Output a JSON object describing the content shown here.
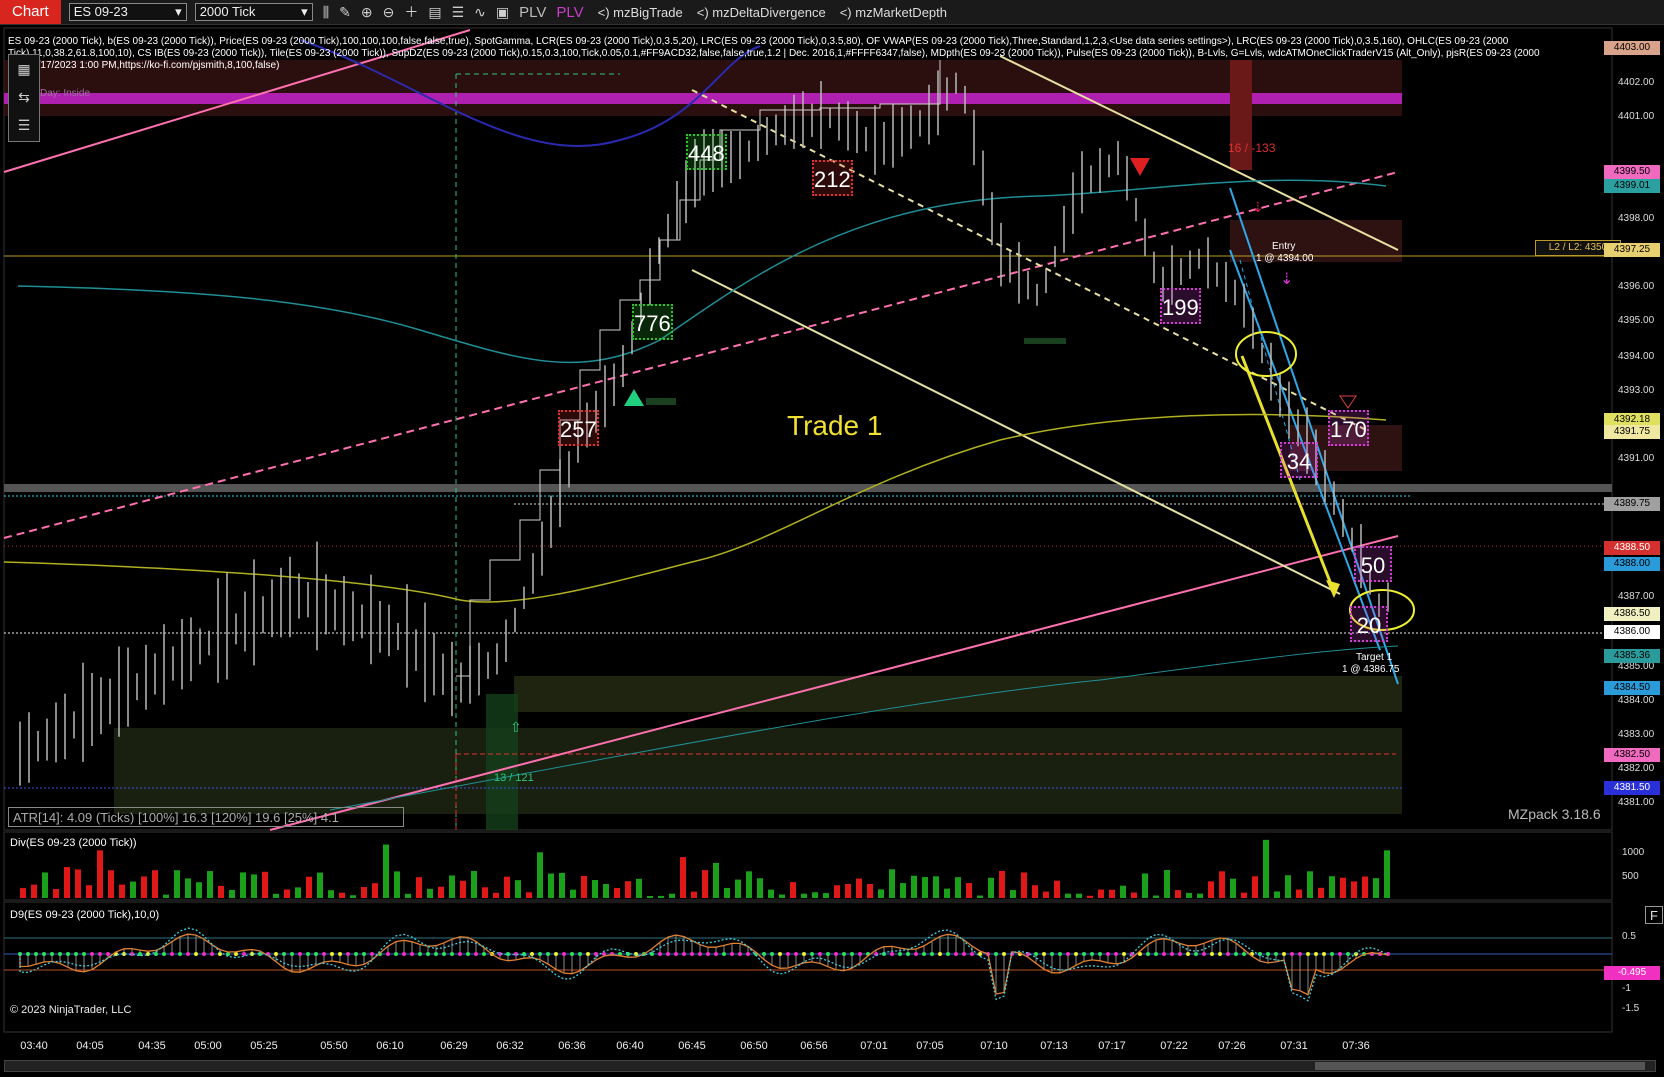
{
  "toolbar": {
    "chart_tab": "Chart",
    "instrument": "ES 09-23",
    "bar_type": "2000 Tick",
    "plv1": "PLV",
    "plv2": "PLV",
    "ind1": "<) mzBigTrade",
    "ind2": "<) mzDeltaDivergence",
    "ind3": "<) mzMarketDepth",
    "icons": [
      "bar-style-icon",
      "draw-pencil-icon",
      "zoom-in-icon",
      "zoom-out-icon",
      "crosshair-icon",
      "data-box-icon",
      "properties-icon",
      "strategy-icon",
      "templates-icon"
    ]
  },
  "info_line": "ES 09-23 (2000 Tick), b(ES 09-23 (2000 Tick)), Price(ES 09-23 (2000 Tick),100,100,100,false,false,true), SpotGamma, LCR(ES 09-23 (2000 Tick),0,3.5,20), LRC(ES 09-23 (2000 Tick),0,3.5,80), OF VWAP(ES 09-23 (2000 Tick),Three,Standard,1,2,3,<Use data series settings>), LRC(ES 09-23 (2000 Tick),0,3.5,160), OHLC(ES 09-23 (2000 Tick),11,0,38.2,61.8,100,10), CS IB(ES 09-23 (2000 Tick)), Tile(ES 09-23 (2000 Tick)), SupDZ(ES 09-23 (2000 Tick),0.15,0.3,100,Tick,0.05,0.1,#FF9ACD32,false,false,true,1.2 | Dec. 2016,1,#FFFF6347,false), MDpth(ES 09-23 (2000 Tick)), Pulse(ES 09-23 (2000 Tick)), B-Lvls, G=Lvls, wdcATMOneClickTraderV15 (Alt_Only), pjsR(ES 09-23 (2000 Tick),6/17/2023 1:00 PM,https://ko-fi.com/pjsmith,8,100,false)",
  "labels": {
    "day_inside": "Day: Inside",
    "trade": "Trade 1",
    "entry_title": "Entry",
    "entry_detail": "1 @ 4394.00",
    "target_title": "Target 1",
    "target_detail": "1 @ 4386.75",
    "delta_top": "16 / -133",
    "delta_bottom": "13 / 121",
    "level_label": "L2 / L2: 4350",
    "atr": "ATR[14]: 4.09 (Ticks) [100%] 16.3 [120%] 19.6 [25%] 4.1",
    "mzpack": "MZpack 3.18.6",
    "div_title": "Div(ES 09-23 (2000 Tick))",
    "d9_title": "D9(ES 09-23 (2000 Tick),10,0)",
    "copyright": "© 2023 NinjaTrader, LLC",
    "f_button": "F"
  },
  "bigtrades": [
    {
      "text": "448",
      "color": "#2ec12e"
    },
    {
      "text": "212",
      "color": "#e03030"
    },
    {
      "text": "776",
      "color": "#2ec12e"
    },
    {
      "text": "257",
      "color": "#e03030"
    },
    {
      "text": "199",
      "color": "#d040d0"
    },
    {
      "text": "170",
      "color": "#d040d0"
    },
    {
      "text": "34",
      "color": "#d040d0"
    },
    {
      "text": "50",
      "color": "#d040d0"
    },
    {
      "text": "20",
      "color": "#d040d0"
    }
  ],
  "price_ticks": [
    "4402.00",
    "4401.00",
    "4399.00",
    "4398.00",
    "4396.00",
    "4395.00",
    "4394.00",
    "4393.00",
    "4391.00",
    "4387.00",
    "4386.00",
    "4385.00",
    "4384.00",
    "4383.00",
    "4382.00",
    "4381.00"
  ],
  "price_boxes": [
    {
      "text": "4403.00",
      "bg": "#d9a28a",
      "fg": "#000"
    },
    {
      "text": "4399.50",
      "bg": "#f06ac0",
      "fg": "#000"
    },
    {
      "text": "4399.01",
      "bg": "#2aa0a0",
      "fg": "#000"
    },
    {
      "text": "4397.25",
      "bg": "#e8d070",
      "fg": "#000"
    },
    {
      "text": "4392.18",
      "bg": "#e0e060",
      "fg": "#000"
    },
    {
      "text": "4391.75",
      "bg": "#f0e8a0",
      "fg": "#000"
    },
    {
      "text": "4389.75",
      "bg": "#a0a0a0",
      "fg": "#000"
    },
    {
      "text": "4388.50",
      "bg": "#d43030",
      "fg": "#fff"
    },
    {
      "text": "4388.00",
      "bg": "#2a9ad8",
      "fg": "#000"
    },
    {
      "text": "4386.50",
      "bg": "#f0f0c0",
      "fg": "#000"
    },
    {
      "text": "4386.00",
      "bg": "#ffffff",
      "fg": "#000"
    },
    {
      "text": "4385.36",
      "bg": "#2a9a9a",
      "fg": "#000"
    },
    {
      "text": "4384.50",
      "bg": "#2a9ad8",
      "fg": "#000"
    },
    {
      "text": "4382.50",
      "bg": "#f06ac0",
      "fg": "#000"
    },
    {
      "text": "4381.50",
      "bg": "#2a30d8",
      "fg": "#fff"
    }
  ],
  "div_ticks": [
    "1000",
    "500"
  ],
  "d9_ticks": [
    "0.5",
    "-1",
    "-1.5"
  ],
  "d9_value": "-0.495",
  "time_ticks": [
    "03:40",
    "04:05",
    "04:35",
    "05:00",
    "05:25",
    "05:50",
    "06:10",
    "06:29",
    "06:32",
    "06:36",
    "06:40",
    "06:45",
    "06:50",
    "06:56",
    "07:01",
    "07:05",
    "07:10",
    "07:13",
    "07:17",
    "07:22",
    "07:26",
    "07:31",
    "07:36"
  ]
}
